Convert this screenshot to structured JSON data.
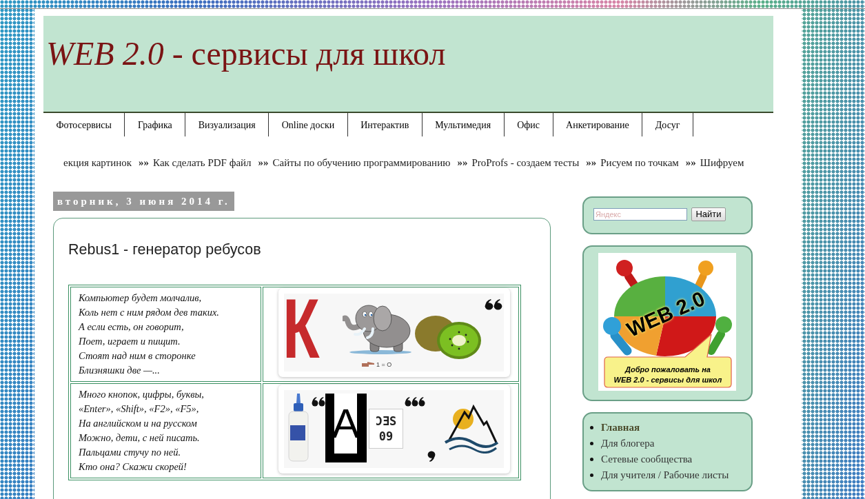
{
  "header": {
    "title": "*WEB 2.0* - сервисы для школ"
  },
  "nav": [
    "Фотосервисы",
    "Графика",
    "Визуализация",
    "Online доски",
    "Интерактив",
    "Мультимедия",
    "Офис",
    "Анкетирование",
    "Досуг"
  ],
  "ticker": {
    "separator": "»»",
    "items": [
      "екция картинок",
      "Как сделать PDF файл",
      "Сайты по обучению программированию",
      "ProProfs - создаем тесты",
      "Рисуем по точкам",
      "Шифруем"
    ]
  },
  "post": {
    "date": "вторник, 3 июня 2014 г.",
    "title": "Rebus1 - генератор ребусов",
    "rows": [
      {
        "poem": [
          "Компьютер будет молчалив,",
          "Коль нет с ним рядом дев таких.",
          "А если есть, он говорит,",
          "Поет, играет и пищит.",
          "Стоят над ним в сторонке",
          "Близняшки две —..."
        ],
        "rebus": {
          "kind": "elephant-kiwi",
          "letter": "К",
          "hint": "1 = О"
        }
      },
      {
        "poem": [
          "Много кнопок, цифры, буквы,",
          "«Enter», «Shift», «F2», «F5»,",
          "На английском и на русском",
          "Можно, дети, с ней писать.",
          "Пальцами стучу по ней.",
          "Кто она? Скажи скорей!"
        ],
        "rebus": {
          "kind": "glue-mountain",
          "letter": "А",
          "display": [
            "ƆƎS",
            "09"
          ]
        }
      }
    ]
  },
  "sidebar": {
    "search": {
      "placeholder": "Яндекс",
      "button": "Найти"
    },
    "logo": {
      "badge": "WEB 2.0",
      "caption": [
        "Добро пожаловать на",
        "WEB 2.0 - сервисы для школ"
      ]
    },
    "pages": [
      {
        "label": "Главная",
        "selected": true
      },
      {
        "label": "Для блогера",
        "selected": false
      },
      {
        "label": "Сетевые сообщества",
        "selected": false
      },
      {
        "label": "Для учителя / Рабочие листы",
        "selected": false
      }
    ]
  }
}
